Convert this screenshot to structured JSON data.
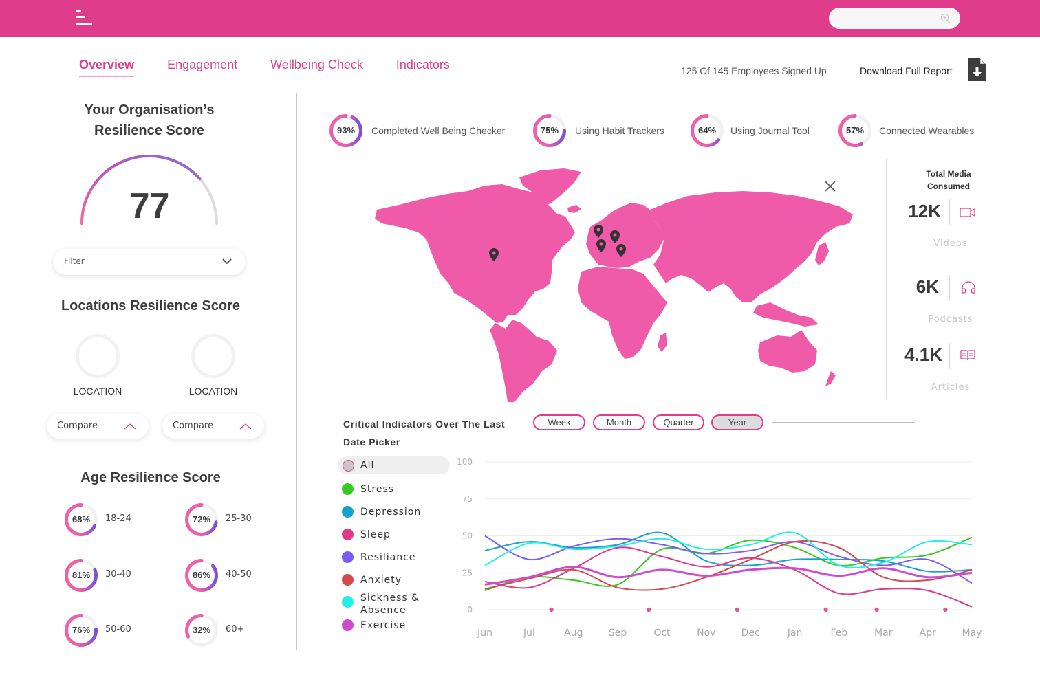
{
  "header": {
    "menu_icon": "hamburger-menu-icon",
    "search": {
      "placeholder": "",
      "value": "",
      "icon": "zoom-in-search-icon"
    }
  },
  "nav": {
    "tabs": [
      {
        "label": "Overview",
        "active": true
      },
      {
        "label": "Engagement",
        "active": false
      },
      {
        "label": "Wellbeing Check",
        "active": false
      },
      {
        "label": "Indicators",
        "active": false
      }
    ],
    "signed_up": "125 Of 145 Employees Signed Up",
    "download_label": "Download Full Report",
    "download_icon": "file-download-icon"
  },
  "organisation": {
    "title_line1": "Your Organisation’s",
    "title_line2": "Resilience Score",
    "score": "77",
    "score_value": 77,
    "filter_label": "Filter"
  },
  "locations": {
    "title": "Locations Resilience Score",
    "items": [
      {
        "label": "LOCATION",
        "compare_label": "Compare"
      },
      {
        "label": "LOCATION",
        "compare_label": "Compare"
      }
    ]
  },
  "age": {
    "title": "Age Resilience Score",
    "items": [
      {
        "percent": 68,
        "percent_label": "68%",
        "range": "18-24"
      },
      {
        "percent": 72,
        "percent_label": "72%",
        "range": "25-30"
      },
      {
        "percent": 81,
        "percent_label": "81%",
        "range": "30-40"
      },
      {
        "percent": 86,
        "percent_label": "86%",
        "range": "40-50"
      },
      {
        "percent": 76,
        "percent_label": "76%",
        "range": "50-60"
      },
      {
        "percent": 32,
        "percent_label": "32%",
        "range": "60+"
      }
    ]
  },
  "stats": [
    {
      "percent": 93,
      "percent_label": "93%",
      "label": "Completed Well Being Checker"
    },
    {
      "percent": 75,
      "percent_label": "75%",
      "label": "Using Habit Trackers"
    },
    {
      "percent": 64,
      "percent_label": "64%",
      "label": "Using Journal Tool"
    },
    {
      "percent": 57,
      "percent_label": "57%",
      "label": "Connected Wearables"
    }
  ],
  "map": {
    "fill_color": "#ef5ba8",
    "markers": [
      "New York",
      "London",
      "Amsterdam",
      "Paris",
      "Milan"
    ],
    "close_icon": "close-icon"
  },
  "media": {
    "title_line1": "Total Media",
    "title_line2": "Consumed",
    "items": [
      {
        "value": "12K",
        "label": "Videos",
        "icon": "video-camera-icon"
      },
      {
        "value": "6K",
        "label": "Podcasts",
        "icon": "headphones-icon"
      },
      {
        "value": "4.1K",
        "label": "Articles",
        "icon": "open-book-icon"
      }
    ]
  },
  "indicators": {
    "title_line1": "Critical Indicators Over The Last",
    "title_line2": "Date Picker",
    "periods": [
      {
        "label": "Week",
        "active": false
      },
      {
        "label": "Month",
        "active": false
      },
      {
        "label": "Quarter",
        "active": false
      },
      {
        "label": "Year",
        "active": true
      }
    ],
    "legend": [
      {
        "label": "All",
        "color": "#c8c8c8"
      },
      {
        "label": "Stress",
        "color": "#36c823"
      },
      {
        "label": "Depression",
        "color": "#18a0cf"
      },
      {
        "label": "Sleep",
        "color": "#e0398a"
      },
      {
        "label": "Resiliance",
        "color": "#7a5cf5"
      },
      {
        "label": "Anxiety",
        "color": "#d24a4a"
      },
      {
        "label": "Sickness &",
        "label2": "Absence",
        "color": "#22f0e6"
      },
      {
        "label": "Exercise",
        "color": "#cc4ccc"
      }
    ]
  },
  "chart_data": {
    "type": "line",
    "title": "Critical Indicators Over The Last Year",
    "x": [
      "Jun",
      "Jul",
      "Aug",
      "Sep",
      "Oct",
      "Nov",
      "Dec",
      "Jan",
      "Feb",
      "Mar",
      "Apr",
      "May"
    ],
    "ylim": [
      0,
      100
    ],
    "yticks": [
      0,
      25,
      50,
      75,
      100
    ],
    "grid": true,
    "series": [
      {
        "name": "Stress",
        "color": "#36c823",
        "values": [
          13,
          22,
          20,
          17,
          41,
          38,
          47,
          42,
          30,
          35,
          37,
          49
        ]
      },
      {
        "name": "Depression",
        "color": "#18a0cf",
        "values": [
          40,
          46,
          42,
          44,
          52,
          33,
          30,
          34,
          34,
          33,
          26,
          27
        ]
      },
      {
        "name": "Sleep",
        "color": "#e0398a",
        "values": [
          19,
          15,
          28,
          42,
          36,
          29,
          35,
          27,
          11,
          14,
          13,
          2
        ]
      },
      {
        "name": "Resiliance",
        "color": "#7a5cf5",
        "values": [
          50,
          34,
          43,
          48,
          44,
          38,
          40,
          46,
          36,
          30,
          34,
          18
        ]
      },
      {
        "name": "Anxiety",
        "color": "#d24a4a",
        "values": [
          14,
          21,
          27,
          15,
          14,
          22,
          34,
          46,
          42,
          22,
          20,
          27
        ]
      },
      {
        "name": "Sickness & Absence",
        "color": "#22f0e6",
        "values": [
          30,
          45,
          41,
          43,
          48,
          41,
          44,
          52,
          30,
          32,
          46,
          44
        ]
      },
      {
        "name": "Exercise",
        "color": "#cc4ccc",
        "values": [
          17,
          22,
          29,
          22,
          27,
          23,
          27,
          28,
          23,
          28,
          22,
          25
        ]
      }
    ],
    "event_markers_x": [
      "Jul-Aug",
      "Sep-Oct",
      "Nov-Dec",
      "Jan-Feb",
      "Feb-Mar",
      "Apr-May"
    ]
  }
}
